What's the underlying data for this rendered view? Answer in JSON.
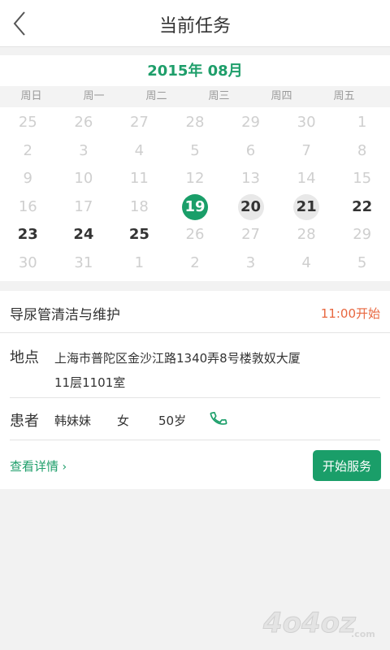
{
  "header": {
    "title": "当前任务",
    "back_icon": "chevron-left-icon"
  },
  "calendar": {
    "month_label": "2015年  08月",
    "weekdays": [
      "周日",
      "周一",
      "周二",
      "周三",
      "周四",
      "周五"
    ],
    "today": "19",
    "marked_days": [
      "20",
      "21"
    ],
    "active_days": [
      "22",
      "23",
      "24",
      "25"
    ],
    "rows": [
      [
        "25",
        "26",
        "27",
        "28",
        "29",
        "30",
        "1"
      ],
      [
        "2",
        "3",
        "4",
        "5",
        "6",
        "7",
        "8"
      ],
      [
        "9",
        "10",
        "11",
        "12",
        "13",
        "14",
        "15"
      ],
      [
        "16",
        "17",
        "18",
        "19",
        "20",
        "21",
        "22"
      ],
      [
        "23",
        "24",
        "25",
        "26",
        "27",
        "28",
        "29"
      ],
      [
        "30",
        "31",
        "1",
        "2",
        "3",
        "4",
        "5"
      ]
    ]
  },
  "task": {
    "name": "导尿管清洁与维护",
    "time": "11:00开始",
    "location_label": "地点",
    "address_line1": "上海市普陀区金沙江路1340弄8号楼敦奴大厦",
    "address_line2": "11层1101室",
    "patient_label": "患者",
    "patient_name": "韩妹妹",
    "patient_gender": "女",
    "patient_age": "50岁",
    "phone_icon": "phone-icon",
    "detail_link": "查看详情",
    "start_button": "开始服务"
  },
  "watermark": {
    "text": "4o4oz.com"
  },
  "colors": {
    "accent": "#1a9e69",
    "time": "#e8673f",
    "muted": "#cfcfcf"
  }
}
